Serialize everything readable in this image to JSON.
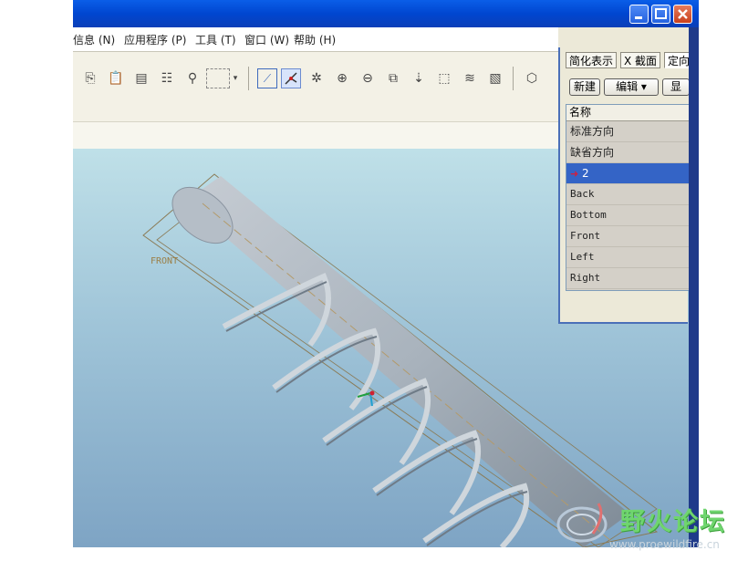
{
  "menubar": {
    "items": [
      "信息 (N)",
      "应用程序 (P)",
      "工具 (T)",
      "窗口 (W)",
      "帮助 (H)"
    ]
  },
  "toolbar": {
    "icons": [
      "copy-icon",
      "paste-icon",
      "paste-special-icon",
      "regenerate-icon",
      "find-icon",
      "selection-box-icon",
      "dropdown-arrow-icon",
      "repaint-icon",
      "spin-center-icon",
      "orient-mode-icon",
      "zoom-in-icon",
      "zoom-out-icon",
      "refit-icon",
      "named-view-icon",
      "layer-icon",
      "view-manager-icon",
      "display-style-icon"
    ]
  },
  "panel": {
    "tabs": [
      "简化表示",
      "X 截面",
      "定向"
    ],
    "new_button": "新建",
    "edit_button": "编辑 ▾",
    "display_button": "显",
    "list_header": "名称",
    "views": [
      {
        "label": "标准方向",
        "selected": false
      },
      {
        "label": "缺省方向",
        "selected": false
      },
      {
        "label": "2",
        "selected": true
      },
      {
        "label": "Back",
        "selected": false
      },
      {
        "label": "Bottom",
        "selected": false
      },
      {
        "label": "Front",
        "selected": false
      },
      {
        "label": "Left",
        "selected": false
      },
      {
        "label": "Right",
        "selected": false
      }
    ]
  },
  "viewport": {
    "datum_label": "FRONT"
  },
  "watermark": {
    "name": "野火论坛",
    "url": "www.proewildfire.cn"
  },
  "colors": {
    "title_bar": "#0a5ee8",
    "selected_row": "#3464c6",
    "viewport_top": "#bfe0e8",
    "viewport_bottom": "#7ea4c4",
    "part": "#a9b3bd"
  }
}
